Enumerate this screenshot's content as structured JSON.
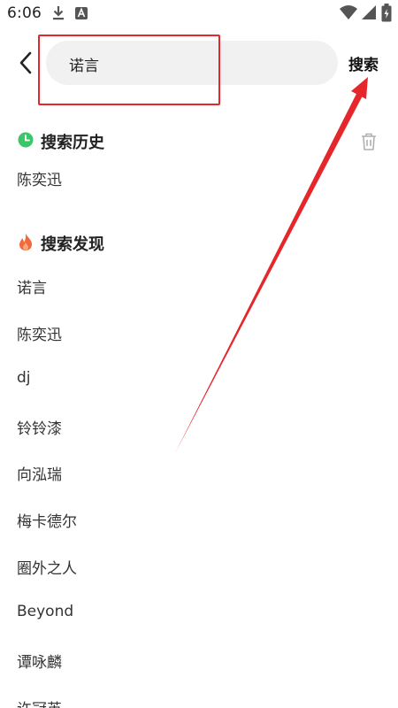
{
  "status_bar": {
    "time": "6:06",
    "icons": [
      "download-icon",
      "app-notification-icon",
      "wifi-icon",
      "signal-icon",
      "battery-icon"
    ]
  },
  "search": {
    "value": "诺言",
    "button_label": "搜索"
  },
  "history": {
    "title": "搜索历史",
    "icon": "clock-icon",
    "items": [
      "陈奕迅"
    ]
  },
  "discover": {
    "title": "搜索发现",
    "icon": "flame-icon",
    "items": [
      "诺言",
      "陈奕迅",
      "dj",
      "铃铃漆",
      "向泓瑞",
      "梅卡德尔",
      "圈外之人",
      "Beyond",
      "谭咏麟",
      "许冠英"
    ]
  },
  "colors": {
    "accent_green": "#3cc66a",
    "flame_orange": "#f06a3c",
    "annotation_red": "#e5262b",
    "search_bg": "#f1f1f1"
  }
}
